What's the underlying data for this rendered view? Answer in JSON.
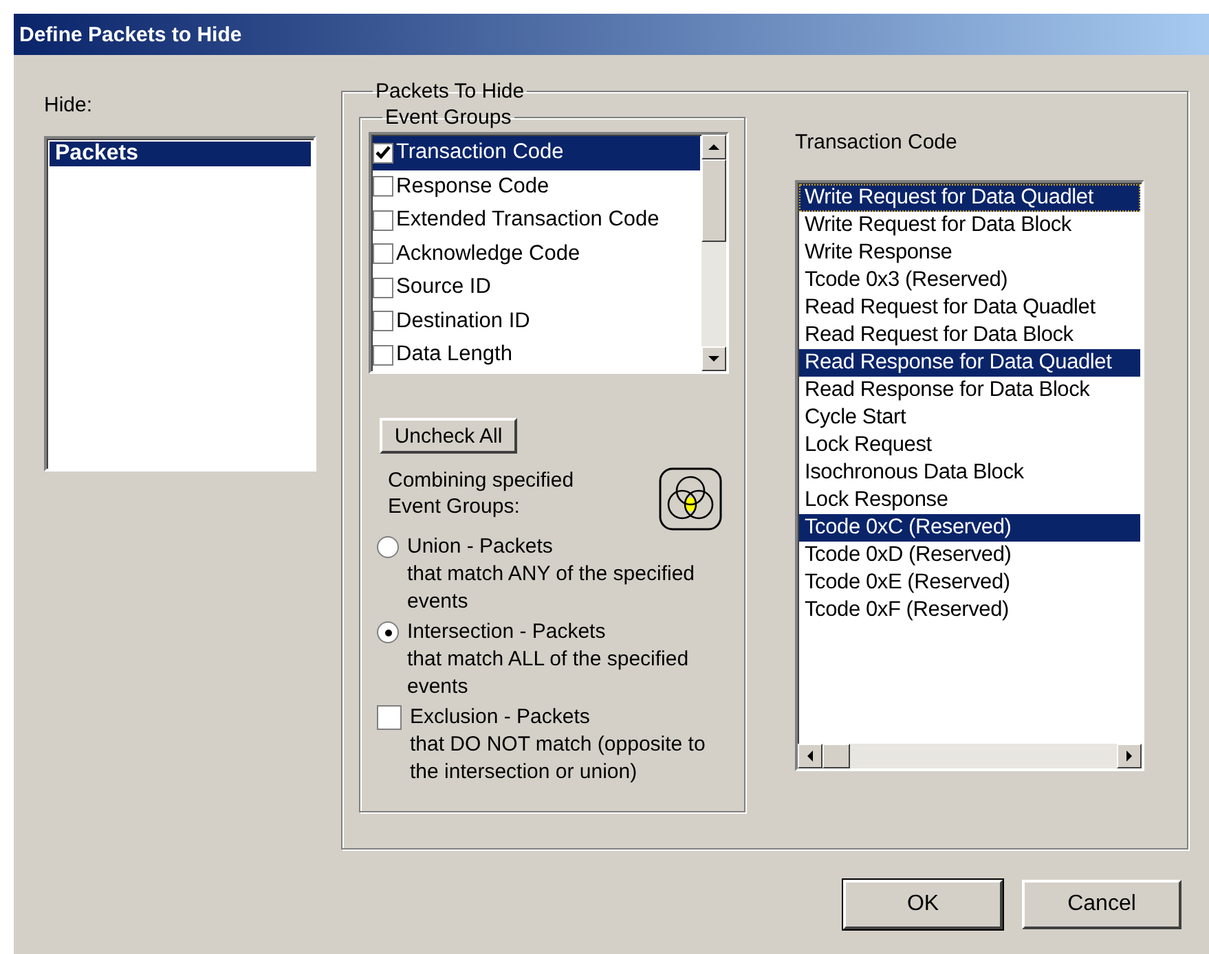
{
  "window": {
    "title": "Define Packets to Hide"
  },
  "hide": {
    "label": "Hide:",
    "items": [
      {
        "label": "Packets",
        "selected": true
      }
    ]
  },
  "packets_to_hide": {
    "title": "Packets To Hide",
    "event_groups": {
      "title": "Event Groups",
      "items": [
        {
          "label": "Transaction Code",
          "checked": true,
          "selected": true
        },
        {
          "label": "Response Code",
          "checked": false,
          "selected": false
        },
        {
          "label": "Extended Transaction Code",
          "checked": false,
          "selected": false
        },
        {
          "label": "Acknowledge Code",
          "checked": false,
          "selected": false
        },
        {
          "label": "Source ID",
          "checked": false,
          "selected": false
        },
        {
          "label": "Destination ID",
          "checked": false,
          "selected": false
        },
        {
          "label": "Data Length",
          "checked": false,
          "selected": false
        }
      ],
      "uncheck_all": "Uncheck All",
      "combining_label": "Combining specified Event Groups:",
      "options": [
        {
          "kind": "radio",
          "title": "Union - Packets",
          "detail": "that match ANY of the specified events",
          "selected": false
        },
        {
          "kind": "radio",
          "title": "Intersection - Packets",
          "detail": "that match ALL of the specified events",
          "selected": true
        },
        {
          "kind": "checkbox",
          "title": "Exclusion - Packets",
          "detail": "that DO NOT match (opposite to the intersection or union)",
          "checked": false
        }
      ]
    },
    "transaction_code": {
      "label": "Transaction Code",
      "items": [
        {
          "label": "Write Request for Data Quadlet",
          "selected": true
        },
        {
          "label": "Write Request for Data Block",
          "selected": false
        },
        {
          "label": "Write Response",
          "selected": false
        },
        {
          "label": "Tcode 0x3 (Reserved)",
          "selected": false
        },
        {
          "label": "Read Request for Data Quadlet",
          "selected": false
        },
        {
          "label": "Read Request for Data Block",
          "selected": false
        },
        {
          "label": "Read Response for Data Quadlet",
          "selected": true
        },
        {
          "label": "Read Response for Data Block",
          "selected": false
        },
        {
          "label": "Cycle Start",
          "selected": false
        },
        {
          "label": "Lock Request",
          "selected": false
        },
        {
          "label": "Isochronous Data Block",
          "selected": false
        },
        {
          "label": "Lock Response",
          "selected": false
        },
        {
          "label": "Tcode 0xC (Reserved)",
          "selected": true
        },
        {
          "label": "Tcode 0xD (Reserved)",
          "selected": false
        },
        {
          "label": "Tcode 0xE (Reserved)",
          "selected": false
        },
        {
          "label": "Tcode 0xF (Reserved)",
          "selected": false
        }
      ]
    }
  },
  "buttons": [
    "OK",
    "Cancel"
  ]
}
